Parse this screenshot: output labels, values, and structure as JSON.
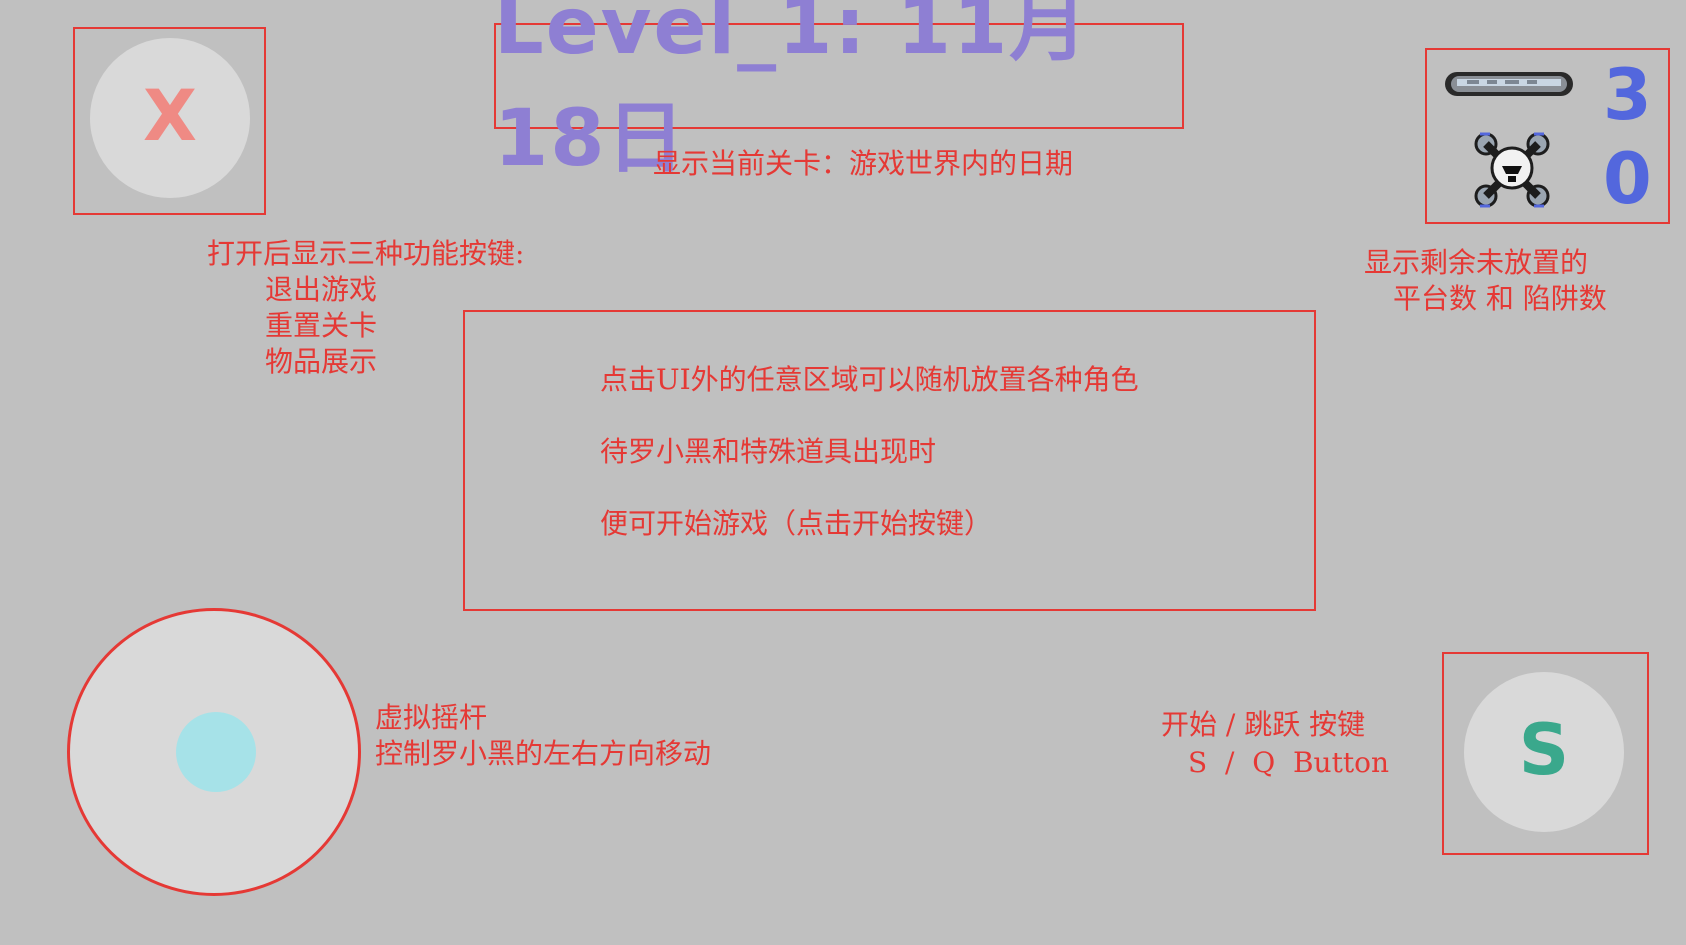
{
  "close_button": {
    "label": "X",
    "color": "#ef8a84"
  },
  "title": {
    "text": "Level_1: 11月18日",
    "color": "#8e7fd3"
  },
  "title_caption": "显示当前关卡：游戏世界内的日期",
  "counters": {
    "platform": {
      "icon": "platform-icon",
      "value": "3"
    },
    "trap": {
      "icon": "trap-icon",
      "value": "0"
    },
    "caption_line1": "显示剩余未放置的",
    "caption_line2": "平台数 和 陷阱数",
    "color": "#5367dd"
  },
  "menu_caption": {
    "line1": "打开后显示三种功能按键:",
    "line2": "退出游戏",
    "line3": "重置关卡",
    "line4": "物品展示"
  },
  "center_info": {
    "line1": "点击UI外的任意区域可以随机放置各种角色",
    "line2": "待罗小黑和特殊道具出现时",
    "line3": "便可开始游戏（点击开始按键）"
  },
  "joystick": {
    "caption_line1": "虚拟摇杆",
    "caption_line2": "控制罗小黑的左右方向移动",
    "knob_color": "#a6e2e8"
  },
  "start_button": {
    "label": "S",
    "caption_line1": "开始 / 跳跃 按键",
    "caption_line2": "S  /  Q  Button",
    "color": "#3aa88c"
  },
  "annotation_color": "#e53935"
}
